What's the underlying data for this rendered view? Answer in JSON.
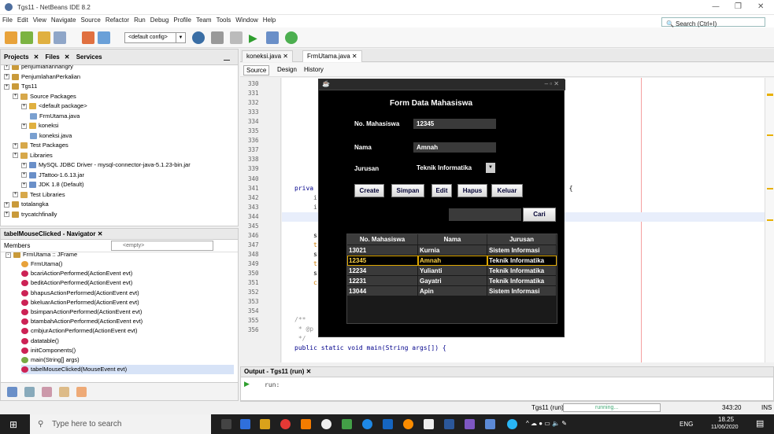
{
  "window": {
    "title": "Tgs11 - NetBeans IDE 8.2"
  },
  "menu": [
    "File",
    "Edit",
    "View",
    "Navigate",
    "Source",
    "Refactor",
    "Run",
    "Debug",
    "Profile",
    "Team",
    "Tools",
    "Window",
    "Help"
  ],
  "search": {
    "placeholder": "Search (Ctrl+I)"
  },
  "toolbar": {
    "config": "<default config>"
  },
  "projects": {
    "tabs": [
      "Projects",
      "Files",
      "Services"
    ],
    "items": [
      {
        "label": "penjumlahanhangry",
        "indent": 1
      },
      {
        "label": "PenjumlahanPerkalian",
        "indent": 1
      },
      {
        "label": "Tgs11",
        "indent": 1
      },
      {
        "label": "Source Packages",
        "indent": 2
      },
      {
        "label": "<default package>",
        "indent": 3
      },
      {
        "label": "FrmUtama.java",
        "indent": 4
      },
      {
        "label": "koneksi",
        "indent": 3
      },
      {
        "label": "koneksi.java",
        "indent": 4
      },
      {
        "label": "Test Packages",
        "indent": 2
      },
      {
        "label": "Libraries",
        "indent": 2
      },
      {
        "label": "MySQL JDBC Driver - mysql-connector-java-5.1.23-bin.jar",
        "indent": 3
      },
      {
        "label": "JTattoo-1.6.13.jar",
        "indent": 3
      },
      {
        "label": "JDK 1.8 (Default)",
        "indent": 3
      },
      {
        "label": "Test Libraries",
        "indent": 2
      },
      {
        "label": "totalangka",
        "indent": 1
      },
      {
        "label": "trycatchfinally",
        "indent": 1
      }
    ]
  },
  "navigator": {
    "title": "tabelMouseClicked - Navigator",
    "members_label": "Members",
    "filter": "<empty>",
    "root": "FrmUtama :: JFrame",
    "items": [
      "FrmUtama()",
      "bcariActionPerformed(ActionEvent evt)",
      "beditActionPerformed(ActionEvent evt)",
      "bhapusActionPerformed(ActionEvent evt)",
      "bkeluarActionPerformed(ActionEvent evt)",
      "bsimpanActionPerformed(ActionEvent evt)",
      "btambahActionPerformed(ActionEvent evt)",
      "cmbjurActionPerformed(ActionEvent evt)",
      "datatable()",
      "initComponents()",
      "main(String[] args)",
      "tabelMouseClicked(MouseEvent evt)"
    ]
  },
  "editor": {
    "tabs": [
      "koneksi.java",
      "FrmUtama.java"
    ],
    "views": [
      "Source",
      "Design",
      "History"
    ],
    "line_numbers": [
      "330",
      "331",
      "332",
      "333",
      "334",
      "335",
      "336",
      "337",
      "338",
      "339",
      "340",
      "341",
      "342",
      "343",
      "344",
      "345",
      "346",
      "347",
      "348",
      "349",
      "350",
      "351",
      "352",
      "353",
      "354",
      "355",
      "356"
    ],
    "code": {
      "l340": "priva",
      "l341": "i",
      "l342": "i",
      "l345": "s",
      "l346": "t",
      "l347": "s",
      "l348": "t",
      "l349": "s",
      "l350": "c",
      "l353": "/**",
      "l354": " * @p",
      "l355": " */",
      "l356": "public static void main(String args[]) {",
      "l340_tail": ") {"
    }
  },
  "output": {
    "title": "Output - Tgs11 (run)",
    "text": "run:"
  },
  "status": {
    "project": "Tgs11 (run)",
    "progress": "running...",
    "position": "343:20",
    "mode": "INS"
  },
  "taskbar": {
    "search_placeholder": "Type here to search",
    "time": "18.25",
    "date": "11/06/2020",
    "lang": "ENG"
  },
  "dialog": {
    "heading": "Form Data Mahasiswa",
    "fields": {
      "no_label": "No. Mahasiswa",
      "no_value": "12345",
      "nama_label": "Nama",
      "nama_value": "Amnah",
      "jurusan_label": "Jurusan",
      "jurusan_value": "Teknik Informatika"
    },
    "buttons": [
      "Create",
      "Simpan",
      "Edit",
      "Hapus",
      "Keluar"
    ],
    "search_button": "Cari",
    "table": {
      "headers": [
        "No. Mahasiswa",
        "Nama",
        "Jurusan"
      ],
      "rows": [
        [
          "13021",
          "Kurnia",
          "Sistem Informasi"
        ],
        [
          "12345",
          "Amnah",
          "Teknik Informatika"
        ],
        [
          "12234",
          "Yulianti",
          "Teknik Informatika"
        ],
        [
          "12231",
          "Gayatri",
          "Teknik Informatika"
        ],
        [
          "13044",
          "Apin",
          "Sistem Informasi"
        ]
      ],
      "selected_row": 1
    }
  }
}
